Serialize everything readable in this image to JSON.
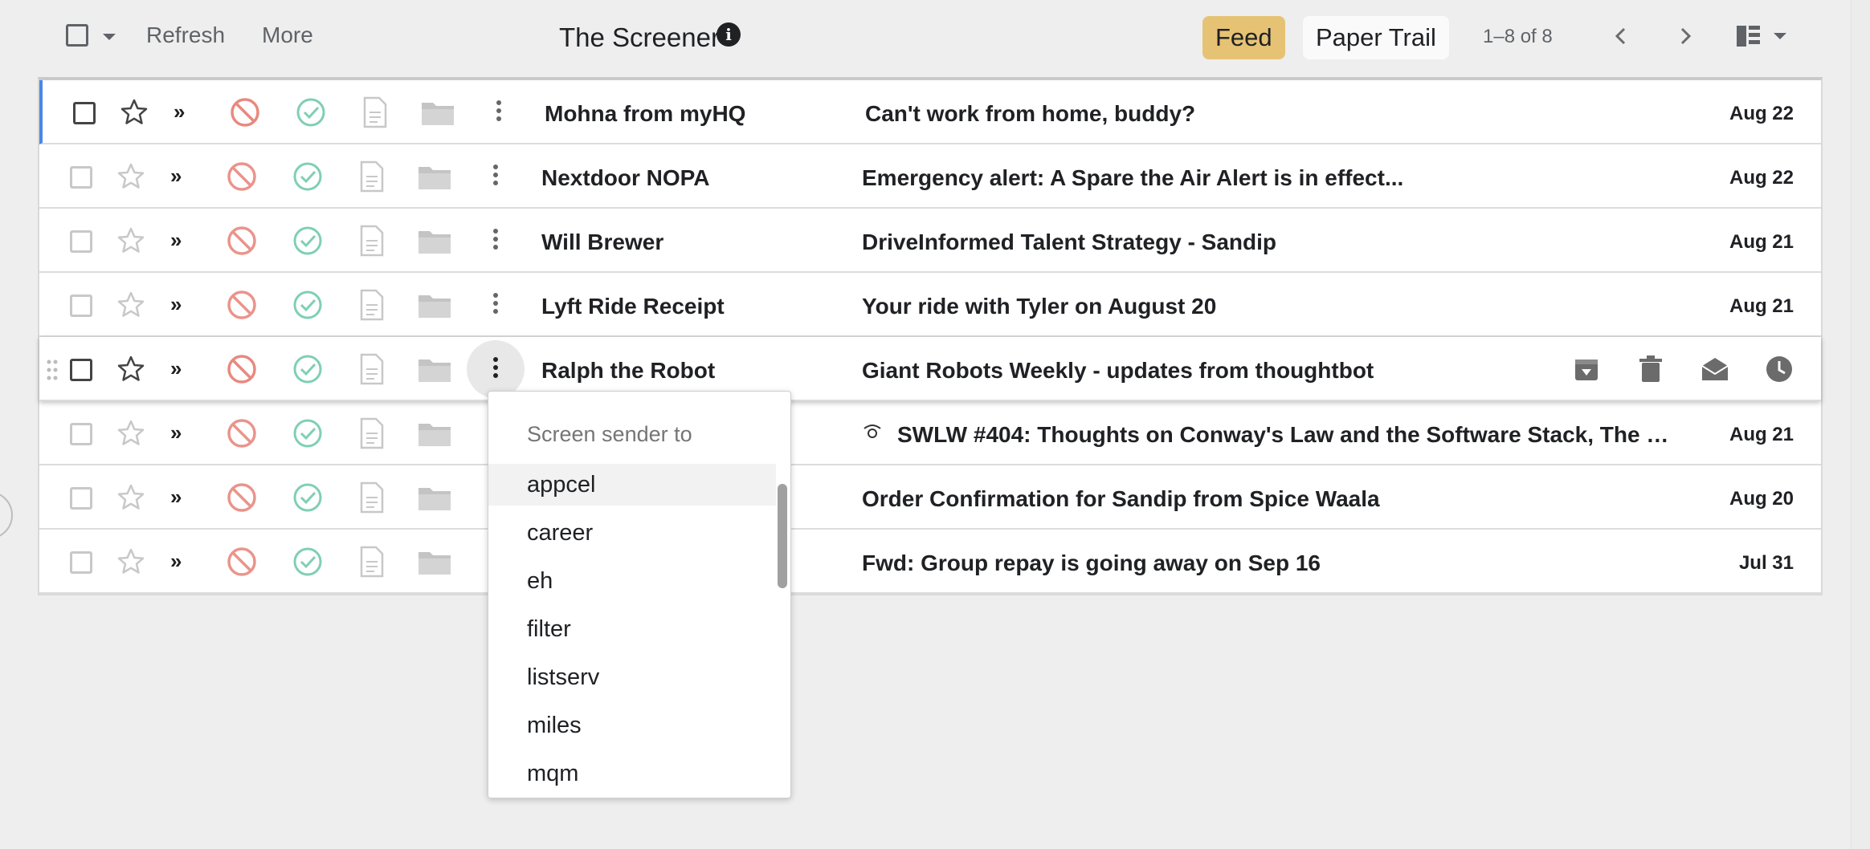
{
  "toolbar": {
    "refresh_label": "Refresh",
    "more_label": "More",
    "title": "The Screener",
    "info_glyph": "i",
    "feed_label": "Feed",
    "paper_trail_label": "Paper Trail",
    "pager_text": "1–8 of 8"
  },
  "colors": {
    "feed_pill": "#e6c374",
    "block_icon": "#e8897f",
    "approve_icon": "#7fcfb4",
    "row_accent": "#4a86e8"
  },
  "rows": [
    {
      "sender": "Mohna from myHQ",
      "subject": "Can't work from home, buddy?",
      "date": "Aug 22"
    },
    {
      "sender": "Nextdoor NOPA",
      "subject": "Emergency alert: A Spare the Air Alert is in effect...",
      "date": "Aug 22"
    },
    {
      "sender": "Will Brewer",
      "subject": "DriveInformed Talent Strategy - Sandip",
      "date": "Aug 21"
    },
    {
      "sender": "Lyft Ride Receipt",
      "subject": "Your ride with Tyler on August 20",
      "date": "Aug 21"
    },
    {
      "sender": "Ralph the Robot",
      "subject": "Giant Robots Weekly - updates from thoughtbot",
      "date": ""
    },
    {
      "sender": "",
      "subject": "SWLW #404: Thoughts on Conway's Law and the Software Stack, The …",
      "date": "Aug 21"
    },
    {
      "sender": "",
      "subject": "Order Confirmation for Sandip from Spice Waala",
      "date": "Aug 20"
    },
    {
      "sender": "",
      "subject": "Fwd: Group repay is going away on Sep 16",
      "date": "Jul 31"
    }
  ],
  "row_icons": [
    "checkbox",
    "star-icon",
    "chevron-double-right-icon",
    "block-icon",
    "approve-check-icon",
    "document-icon",
    "folder-icon",
    "more-vert-icon"
  ],
  "hover_actions": [
    "archive-icon",
    "trash-icon",
    "mark-read-icon",
    "snooze-clock-icon"
  ],
  "dropdown": {
    "heading": "Screen sender to",
    "items": [
      "appcel",
      "career",
      "eh",
      "filter",
      "listserv",
      "miles",
      "mqm"
    ],
    "selected": "appcel"
  }
}
